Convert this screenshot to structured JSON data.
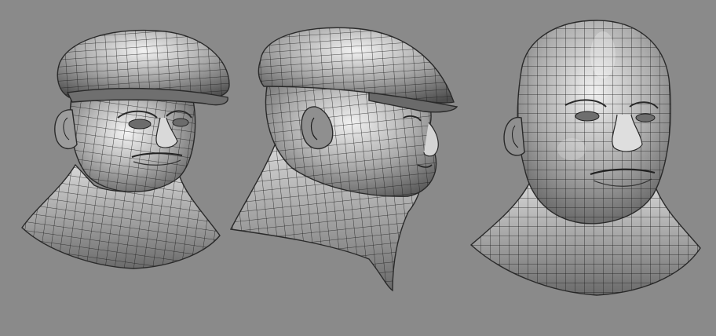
{
  "scene": {
    "background_color": "#8a8a8a",
    "mesh_color": "#1c1c1c",
    "models": [
      {
        "id": "head-front-three-quarter",
        "wears_cap": true
      },
      {
        "id": "head-side-profile",
        "wears_cap": true
      },
      {
        "id": "head-front-bald",
        "wears_cap": false
      }
    ]
  }
}
